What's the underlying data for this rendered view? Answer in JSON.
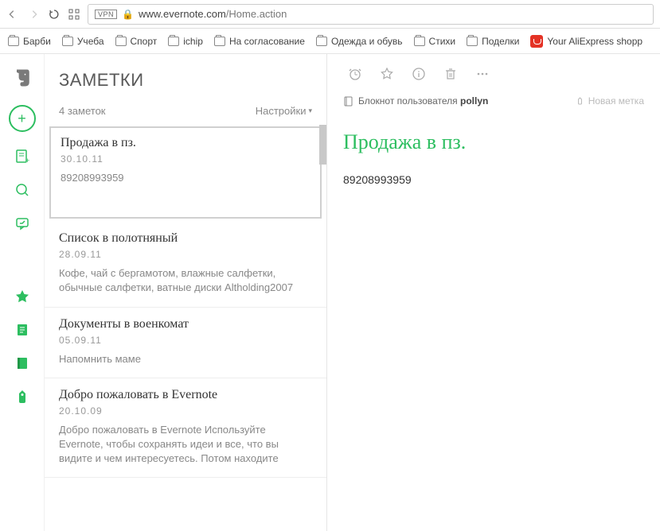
{
  "browser": {
    "url_host": "www.evernote.com",
    "url_path": "/Home.action",
    "vpn": "VPN"
  },
  "bookmarks": [
    {
      "label": "Барби",
      "type": "folder"
    },
    {
      "label": "Учеба",
      "type": "folder"
    },
    {
      "label": "Спорт",
      "type": "folder"
    },
    {
      "label": "ichip",
      "type": "folder"
    },
    {
      "label": "На согласование",
      "type": "folder"
    },
    {
      "label": "Одежда и обувь",
      "type": "folder"
    },
    {
      "label": "Стихи",
      "type": "folder"
    },
    {
      "label": "Поделки",
      "type": "folder"
    },
    {
      "label": "Your AliExpress shopp",
      "type": "ali"
    }
  ],
  "notes_panel": {
    "title": "ЗАМЕТКИ",
    "count": "4 заметок",
    "settings": "Настройки"
  },
  "notes": [
    {
      "title": "Продажа в пз.",
      "date": "30.10.11",
      "snippet": "89208993959"
    },
    {
      "title": "Список в полотняный",
      "date": "28.09.11",
      "snippet": "Кофе, чай с бергамотом, влажные салфетки, обычные салфетки, ватные диски Altholding2007"
    },
    {
      "title": "Документы в военкомат",
      "date": "05.09.11",
      "snippet": "Напомнить маме"
    },
    {
      "title": "Добро пожаловать в Evernote",
      "date": "20.10.09",
      "snippet": "Добро пожаловать в Evernote Используйте Evernote, чтобы сохранять идеи и все, что вы видите и чем интересуетесь. Потом находите"
    }
  ],
  "detail": {
    "notebook_prefix": "Блокнот пользователя",
    "username": "pollyn",
    "new_tag": "Новая метка",
    "title": "Продажа в пз.",
    "body": "89208993959"
  }
}
